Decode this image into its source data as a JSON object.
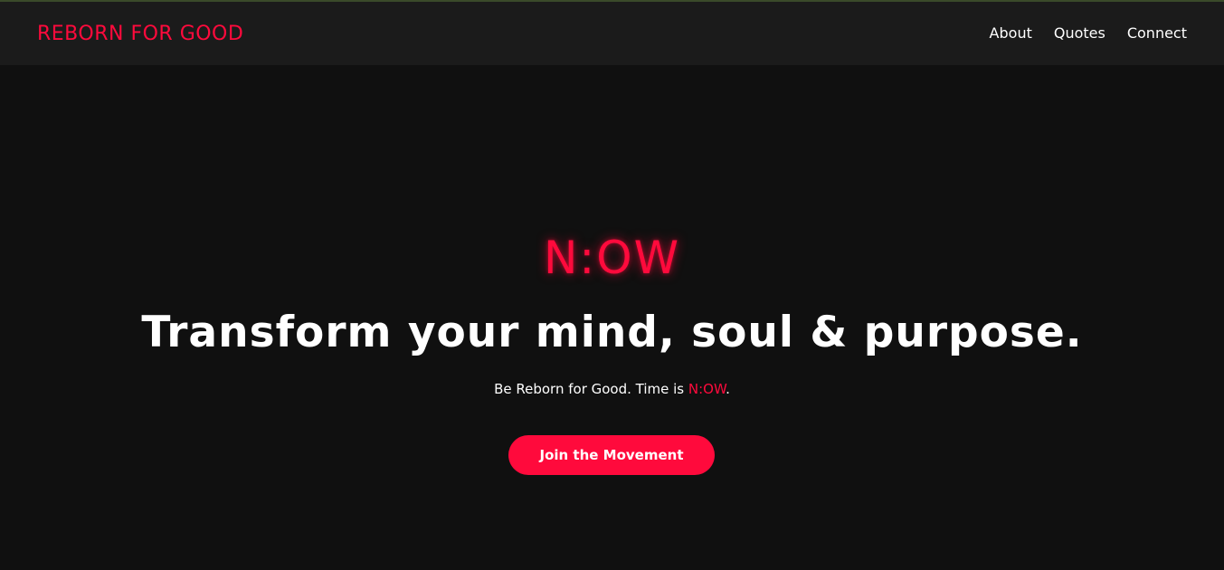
{
  "header": {
    "brand": "REBORN FOR GOOD",
    "nav": [
      {
        "label": "About"
      },
      {
        "label": "Quotes"
      },
      {
        "label": "Connect"
      }
    ]
  },
  "hero": {
    "kicker": "N:OW",
    "title": "Transform your mind, soul & purpose.",
    "subtitle_prefix": "Be Reborn for Good. Time is ",
    "subtitle_accent": "N:OW",
    "subtitle_suffix": ".",
    "cta_label": "Join the Movement"
  },
  "colors": {
    "accent": "#ff0a3c",
    "background": "#101010",
    "header_background": "#1b1b1b",
    "text": "#ffffff"
  }
}
